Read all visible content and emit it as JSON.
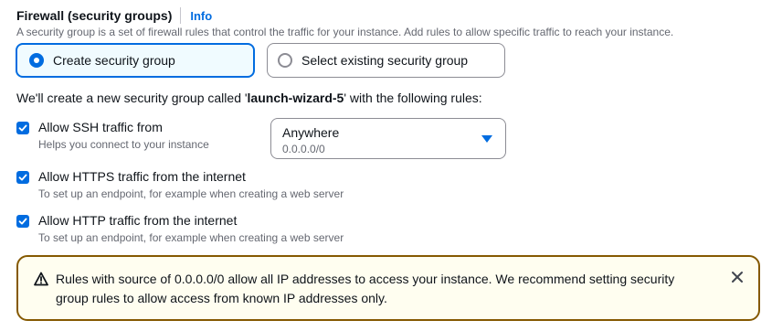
{
  "header": {
    "title": "Firewall (security groups)",
    "info_link": "Info"
  },
  "description": "A security group is a set of firewall rules that control the traffic for your instance. Add rules to allow specific traffic to reach your instance.",
  "options": {
    "create": {
      "label": "Create security group",
      "selected": true
    },
    "existing": {
      "label": "Select existing security group",
      "selected": false
    }
  },
  "sg_line": {
    "prefix": "We'll create a new security group called '",
    "name": "launch-wizard-5",
    "suffix": "' with the following rules:"
  },
  "rules": [
    {
      "label": "Allow SSH traffic from",
      "hint": "Helps you connect to your instance",
      "checked": true
    },
    {
      "label": "Allow HTTPS traffic from the internet",
      "hint": "To set up an endpoint, for example when creating a web server",
      "checked": true
    },
    {
      "label": "Allow HTTP traffic from the internet",
      "hint": "To set up an endpoint, for example when creating a web server",
      "checked": true
    }
  ],
  "ssh_source": {
    "value": "Anywhere",
    "description": "0.0.0.0/0"
  },
  "alert": {
    "text": "Rules with source of 0.0.0.0/0 allow all IP addresses to access your instance. We recommend setting security group rules to allow access from known IP addresses only."
  },
  "colors": {
    "accent": "#006ce0",
    "warning_border": "#855900",
    "warning_bg": "#fffef0"
  }
}
